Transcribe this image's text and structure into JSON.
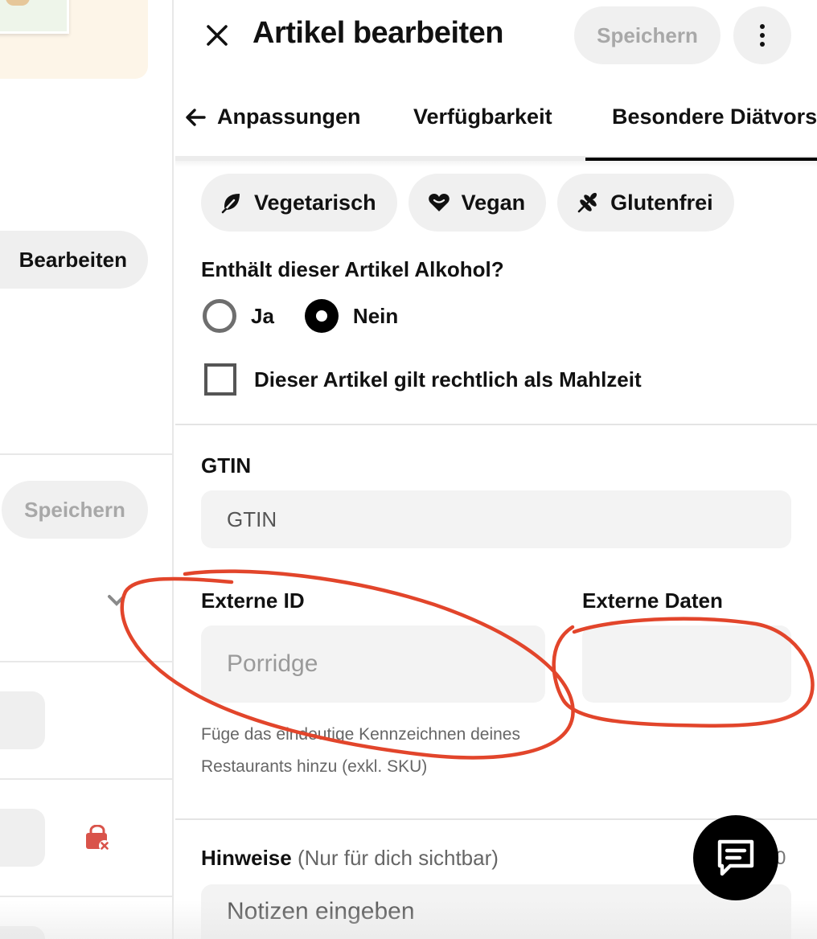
{
  "header": {
    "title": "Artikel bearbeiten",
    "save_label": "Speichern",
    "more_icon": "more-vertical-icon",
    "close_icon": "close-icon"
  },
  "tabs": [
    {
      "label": "Anpassungen",
      "icon": "arrow-left-icon"
    },
    {
      "label": "Verfügbarkeit"
    },
    {
      "label": "Besondere Diätvorschriften",
      "active": true
    }
  ],
  "diet_chips": [
    {
      "label": "Vegetarisch",
      "icon": "leaf-icon"
    },
    {
      "label": "Vegan",
      "icon": "heart-icon"
    },
    {
      "label": "Glutenfrei",
      "icon": "wheat-icon"
    }
  ],
  "alcohol": {
    "question": "Enthält dieser Artikel Alkohol?",
    "options": [
      {
        "label": "Ja",
        "selected": false
      },
      {
        "label": "Nein",
        "selected": true
      }
    ]
  },
  "meal_checkbox": {
    "label": "Dieser Artikel gilt rechtlich als Mahlzeit",
    "checked": false
  },
  "gtin": {
    "label": "GTIN",
    "placeholder": "GTIN",
    "value": ""
  },
  "external_id": {
    "label": "Externe ID",
    "placeholder": "Porridge",
    "value": "",
    "helper": "Füge das eindeutige Kennzeichnen deines Restaurants hinzu (exkl. SKU)"
  },
  "external_data": {
    "label": "Externe Daten",
    "value": ""
  },
  "notes": {
    "label": "Hinweise",
    "sublabel": "(Nur für dich sichtbar)",
    "count": "0",
    "placeholder": "Notizen eingeben"
  },
  "background": {
    "edit_label": "Bearbeiten",
    "save_label": "Speichern"
  },
  "colors": {
    "annotation": "#e2452b",
    "active_tab": "#000000",
    "disabled_text": "#a8a8a8",
    "chip_bg": "#f0f0f0"
  }
}
